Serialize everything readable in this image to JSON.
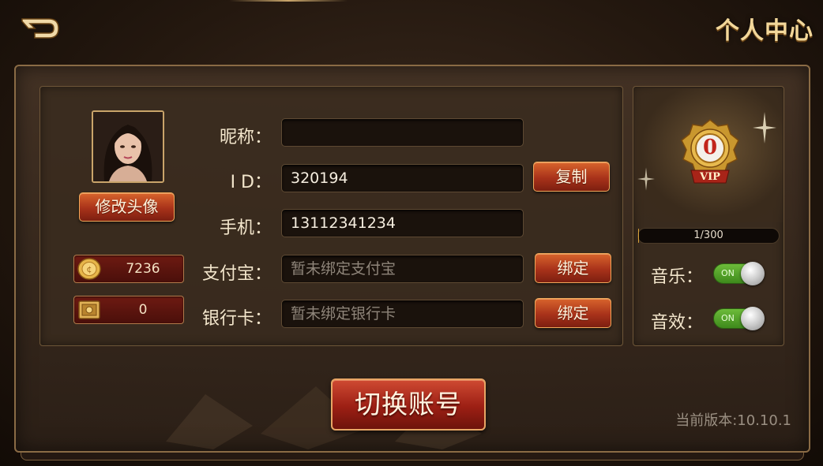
{
  "header": {
    "title": "个人中心",
    "back_icon": "back-arrow-icon"
  },
  "profile": {
    "change_avatar_label": "修改头像",
    "coins": "7236",
    "safe_balance": "0",
    "coin_icon": "gold-coin-icon",
    "safe_icon": "safe-box-icon"
  },
  "form": {
    "nickname_label": "昵称：",
    "nickname_value": "",
    "id_label": "I D：",
    "id_value": "320194",
    "copy_label": "复制",
    "phone_label": "手机：",
    "phone_value": "13112341234",
    "alipay_label": "支付宝：",
    "alipay_placeholder": "暂未绑定支付宝",
    "alipay_bind_label": "绑定",
    "bank_label": "银行卡：",
    "bank_placeholder": "暂未绑定银行卡",
    "bank_bind_label": "绑定"
  },
  "vip": {
    "level": "0",
    "badge_text": "VIP",
    "progress_text": "1/300",
    "progress_fraction": 0.0033
  },
  "settings": {
    "music_label": "音乐：",
    "music_state": "ON",
    "sfx_label": "音效：",
    "sfx_state": "ON"
  },
  "footer": {
    "switch_account_label": "切换账号",
    "version_text": "当前版本:10.10.1"
  },
  "colors": {
    "accent_gold": "#c9a46a",
    "button_red": "#a8321a",
    "toggle_green": "#4f9e28"
  }
}
